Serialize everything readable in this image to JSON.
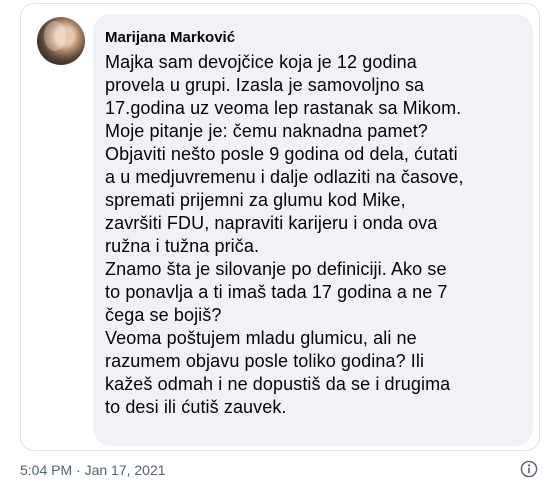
{
  "post": {
    "author": "Marijana Marković",
    "lines": [
      "Majka sam devojčice koja je 12 godina",
      "provela u grupi. Izasla je samovoljno sa",
      "17.godina uz veoma lep rastanak sa Mikom.",
      "Moje pitanje je: čemu naknadna pamet?",
      "Objaviti nešto posle 9 godina od dela, ćutati",
      "a u medjuvremenu i dalje odlaziti na časove,",
      "spremati prijemni za glumu kod Mike,",
      "završiti FDU, napraviti karijeru i onda ova",
      "ružna i tužna priča.",
      "Znamo šta je silovanje po definiciji. Ako se",
      "to ponavlja a ti imaš tada 17 godina a ne 7",
      "čega se bojiš?",
      "Veoma poštujem mladu glumicu, ali ne",
      "razumem objavu posle toliko godina? Ili",
      "kažeš odmah i ne dopustiš da se i drugima",
      "to desi ili ćutiš zauvek."
    ]
  },
  "footer": {
    "timestamp": "5:04 PM · Jan 17, 2021",
    "info_icon": "info-icon"
  },
  "colors": {
    "bubble": "#f0f2f5",
    "text": "#050505",
    "muted": "#536471"
  }
}
